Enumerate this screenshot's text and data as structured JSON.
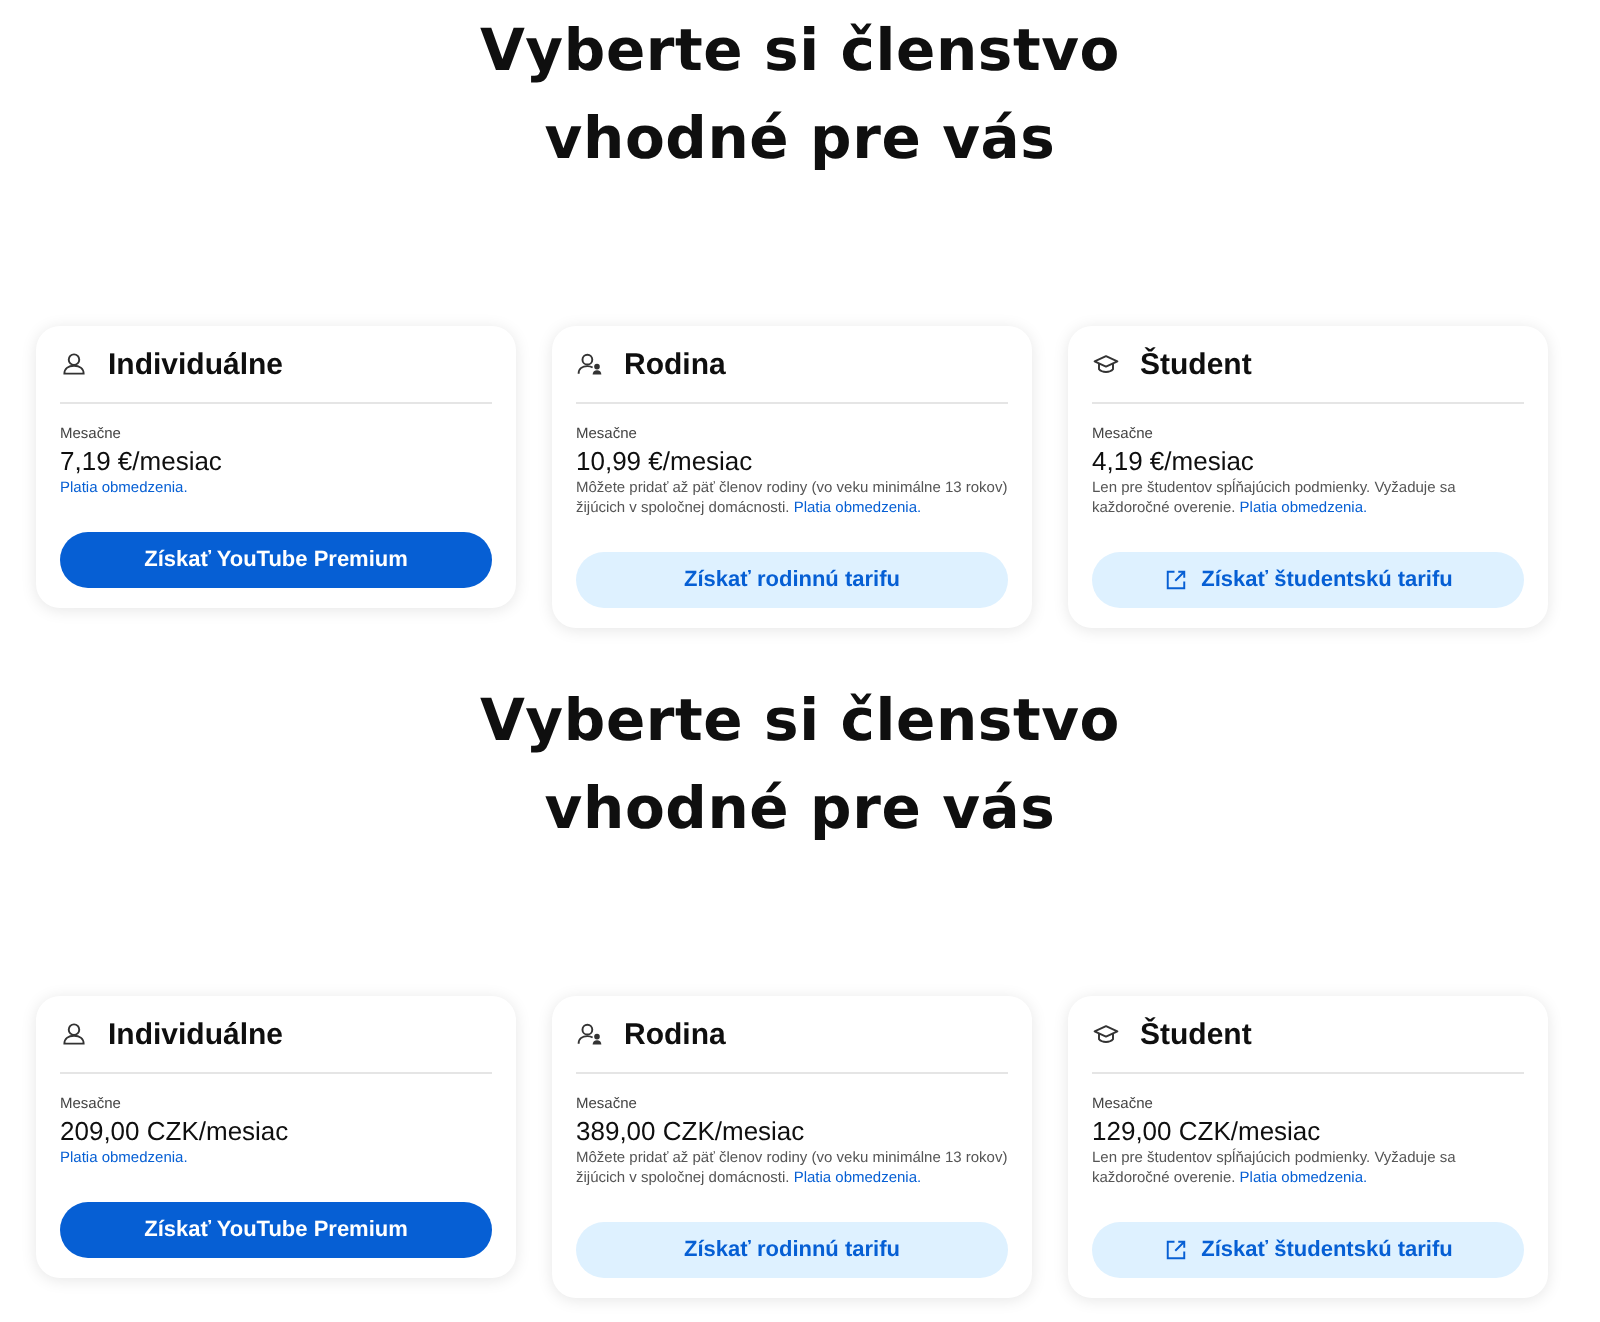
{
  "sections": [
    {
      "heading": "Vyberte si členstvo vhodné pre vás",
      "plans": [
        {
          "kind": "individual",
          "title": "Individuálne",
          "period": "Mesačne",
          "price": "7,19 €/mesiac",
          "link": "Platia obmedzenia.",
          "button": {
            "label": "Získať YouTube Premium",
            "kind": "primary",
            "external": false
          }
        },
        {
          "kind": "family",
          "title": "Rodina",
          "period": "Mesačne",
          "price": "10,99 €/mesiac",
          "note": "Môžete pridať až päť členov rodiny (vo veku minimálne 13 rokov) žijúcich v spoločnej domácnosti.",
          "link": "Platia obmedzenia.",
          "button": {
            "label": "Získať rodinnú tarifu",
            "kind": "secondary",
            "external": false
          }
        },
        {
          "kind": "student",
          "title": "Študent",
          "period": "Mesačne",
          "price": "4,19 €/mesiac",
          "note": "Len pre študentov spĺňajúcich podmienky. Vyžaduje sa každoročné overenie.",
          "link": "Platia obmedzenia.",
          "button": {
            "label": "Získať študentskú tarifu",
            "kind": "secondary",
            "external": true
          }
        }
      ]
    },
    {
      "heading": "Vyberte si členstvo vhodné pre vás",
      "plans": [
        {
          "kind": "individual",
          "title": "Individuálne",
          "period": "Mesačne",
          "price": "209,00 CZK/mesiac",
          "link": "Platia obmedzenia.",
          "button": {
            "label": "Získať YouTube Premium",
            "kind": "primary",
            "external": false
          }
        },
        {
          "kind": "family",
          "title": "Rodina",
          "period": "Mesačne",
          "price": "389,00 CZK/mesiac",
          "note": "Môžete pridať až päť členov rodiny (vo veku minimálne 13 rokov) žijúcich v spoločnej domácnosti.",
          "link": "Platia obmedzenia.",
          "button": {
            "label": "Získať rodinnú tarifu",
            "kind": "secondary",
            "external": false
          }
        },
        {
          "kind": "student",
          "title": "Študent",
          "period": "Mesačne",
          "price": "129,00 CZK/mesiac",
          "note": "Len pre študentov spĺňajúcich podmienky. Vyžaduje sa každoročné overenie.",
          "link": "Platia obmedzenia.",
          "button": {
            "label": "Získať študentskú tarifu",
            "kind": "secondary",
            "external": true
          }
        }
      ]
    }
  ]
}
